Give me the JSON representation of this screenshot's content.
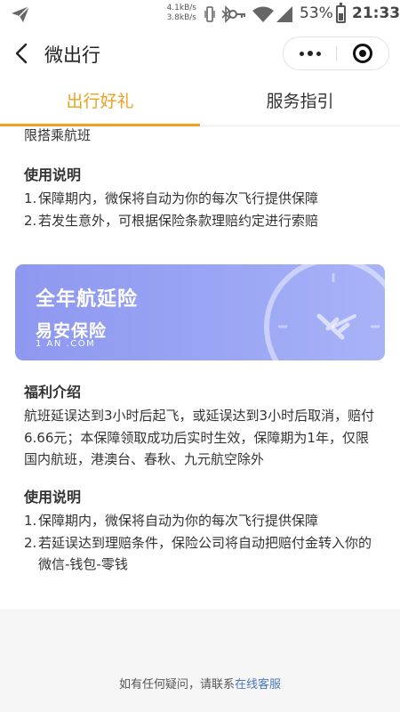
{
  "status_bar": {
    "speed_up": "4.1kB/s",
    "speed_down": "3.8kB/s",
    "battery": "53%",
    "time": "21:33"
  },
  "nav": {
    "title": "微出行"
  },
  "tabs": [
    {
      "label": "出行好礼",
      "active": true
    },
    {
      "label": "服务指引",
      "active": false
    }
  ],
  "section1": {
    "tail_text": "限搭乘航班",
    "usage_heading": "使用说明",
    "usage_items": [
      "保障期内，微保将自动为你的每次飞行提供保障",
      "若发生意外，可根据保险条款理赔约定进行索赔"
    ]
  },
  "card": {
    "title": "全年航延险",
    "logo_cn": "易安保险",
    "logo_en": "1 AN .COM",
    "accent": "#8e98ef"
  },
  "section2": {
    "benefit_heading": "福利介绍",
    "benefit_text": "航班延误达到3小时后起飞，或延误达到3小时后取消，赔付6.66元；本保障领取成功后实时生效，保障期为1年，仅限国内航班，港澳台、春秋、九元航空除外",
    "usage_heading": "使用说明",
    "usage_items": [
      "保障期内，微保将自动为你的每次飞行提供保障",
      "若延误达到理赔条件，保险公司将自动把赔付金转入你的微信-钱包-零钱"
    ]
  },
  "footer": {
    "contact_prefix": "如有任何疑问，请联系",
    "contact_link": "在线客服"
  },
  "colors": {
    "active_tab": "#f0a01c",
    "link": "#4a78c2"
  }
}
